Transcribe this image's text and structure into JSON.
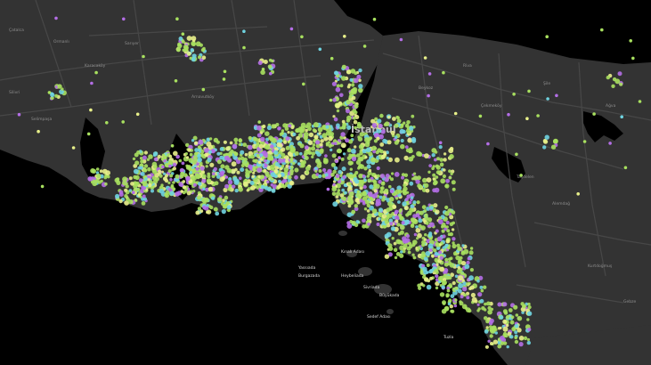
{
  "map": {
    "city_label": "İstanbul",
    "palette": {
      "sea": "#000000",
      "land": "#333333",
      "road": "#4a4a4a",
      "label": "#8d8d8d",
      "marker_primary": "#a8e05f",
      "marker_secondary": "#6fd3e0",
      "marker_accent": "#b46ee6",
      "marker_highlight": "#e8f08a"
    },
    "island_labels": [
      "Kınalı Adası",
      "Burgazada",
      "Heybeliada",
      "Büyükada",
      "Sedef Adası",
      "Yassıada",
      "Sivriada",
      "Tuzla"
    ]
  }
}
